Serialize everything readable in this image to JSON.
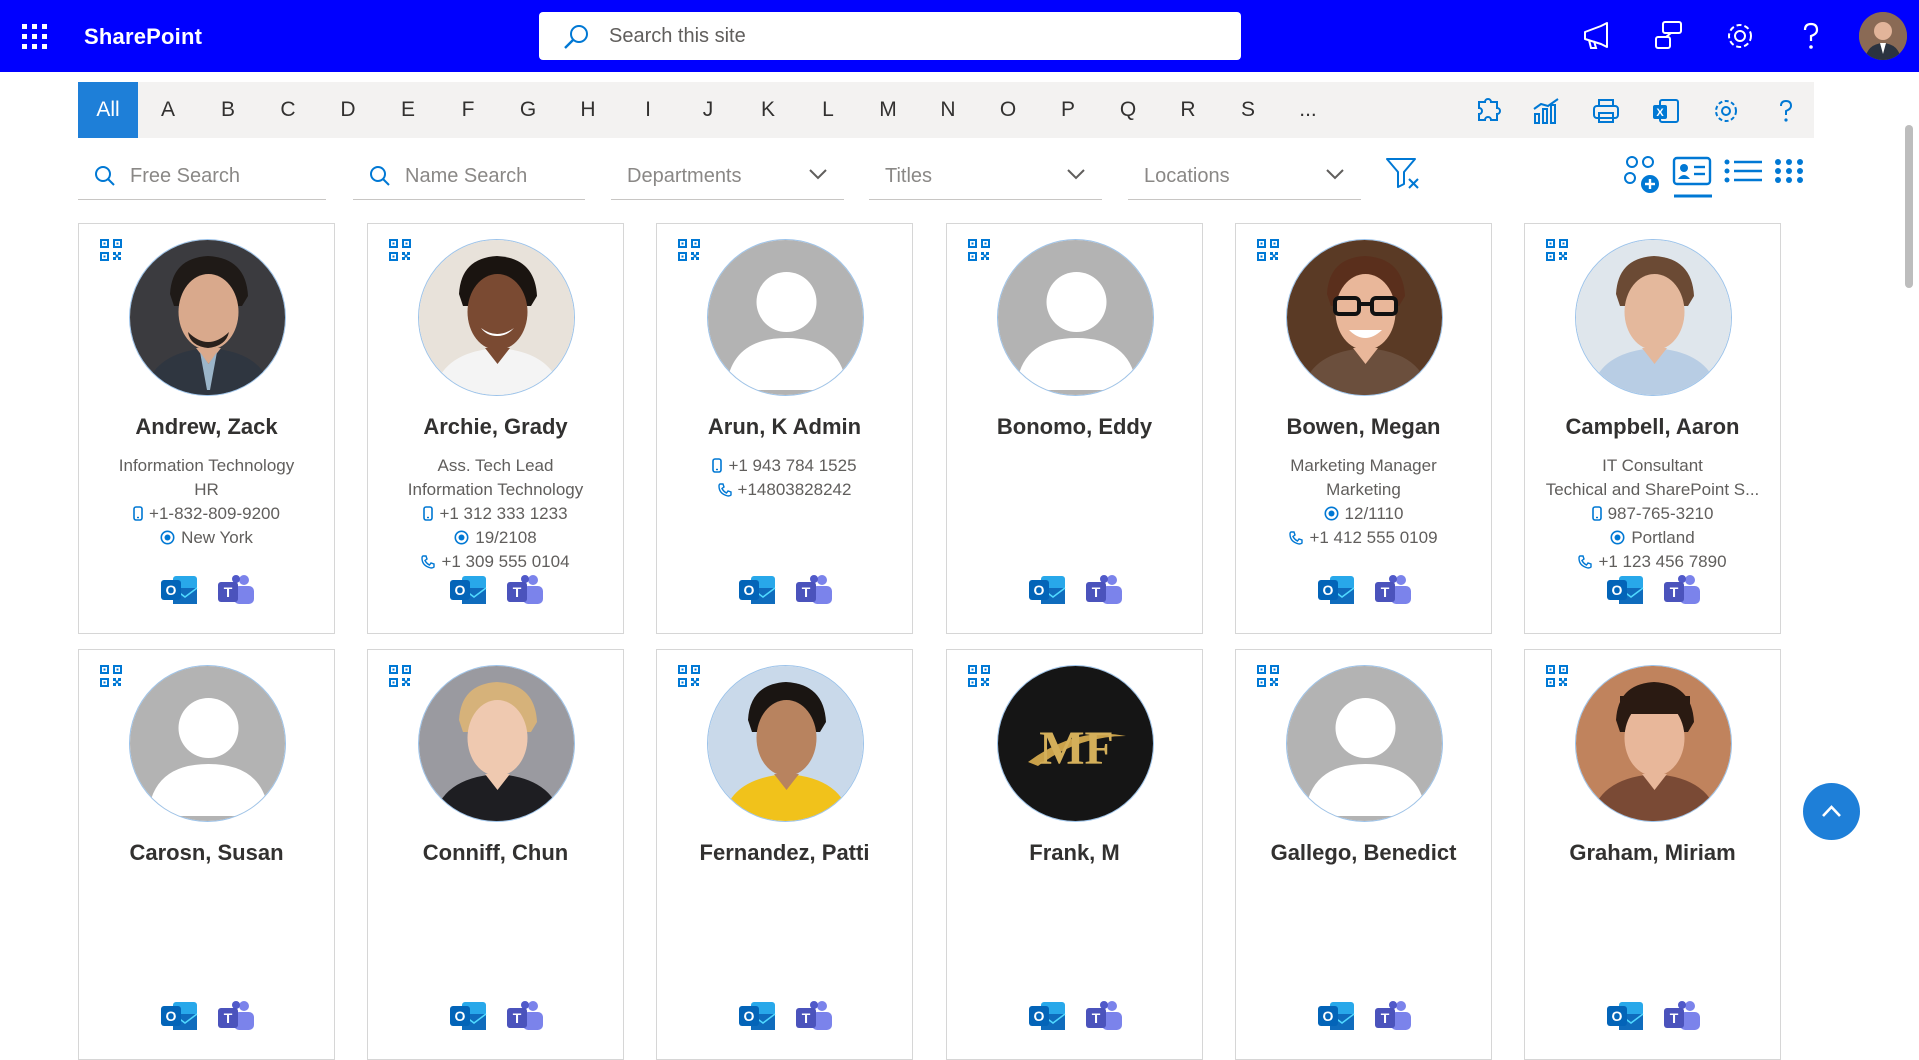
{
  "app": {
    "name": "SharePoint"
  },
  "search": {
    "placeholder": "Search this site"
  },
  "alphabet": [
    "All",
    "A",
    "B",
    "C",
    "D",
    "E",
    "F",
    "G",
    "H",
    "I",
    "J",
    "K",
    "L",
    "M",
    "N",
    "O",
    "P",
    "Q",
    "R",
    "S",
    "..."
  ],
  "active_letter": "All",
  "filters": {
    "free_search_placeholder": "Free Search",
    "name_search_placeholder": "Name Search",
    "departments": "Departments",
    "titles": "Titles",
    "locations": "Locations"
  },
  "colors": {
    "suite_bar": "#0000ff",
    "accent": "#1e7fd8",
    "outlook": "#0f6cbd",
    "teams": "#5b5fc7"
  },
  "people": [
    {
      "name": "Andrew, Zack",
      "lines": [
        {
          "icon": "",
          "text": "Information Technology"
        },
        {
          "icon": "",
          "text": "HR"
        },
        {
          "icon": "mobile-icon",
          "text": "+1-832-809-9200"
        },
        {
          "icon": "location-icon",
          "text": "New York"
        }
      ]
    },
    {
      "name": "Archie, Grady",
      "lines": [
        {
          "icon": "",
          "text": "Ass. Tech Lead"
        },
        {
          "icon": "",
          "text": "Information Technology"
        },
        {
          "icon": "mobile-icon",
          "text": "+1 312 333 1233"
        },
        {
          "icon": "location-icon",
          "text": "19/2108"
        },
        {
          "icon": "phone-icon",
          "text": "+1 309 555 0104"
        }
      ]
    },
    {
      "name": "Arun, K Admin",
      "lines": [
        {
          "icon": "mobile-icon",
          "text": "+1 943 784 1525"
        },
        {
          "icon": "phone-icon",
          "text": "+14803828242"
        }
      ]
    },
    {
      "name": "Bonomo, Eddy",
      "lines": []
    },
    {
      "name": "Bowen, Megan",
      "lines": [
        {
          "icon": "",
          "text": "Marketing Manager"
        },
        {
          "icon": "",
          "text": "Marketing"
        },
        {
          "icon": "location-icon",
          "text": "12/1110"
        },
        {
          "icon": "phone-icon",
          "text": "+1 412 555 0109"
        }
      ]
    },
    {
      "name": "Campbell, Aaron",
      "lines": [
        {
          "icon": "",
          "text": "IT Consultant"
        },
        {
          "icon": "",
          "text": "Techical and SharePoint S..."
        },
        {
          "icon": "mobile-icon",
          "text": "987-765-3210"
        },
        {
          "icon": "location-icon",
          "text": "Portland"
        },
        {
          "icon": "phone-icon",
          "text": "+1 123 456 7890"
        }
      ]
    },
    {
      "name": "Carosn, Susan",
      "lines": []
    },
    {
      "name": "Conniff, Chun",
      "lines": []
    },
    {
      "name": "Fernandez, Patti",
      "lines": []
    },
    {
      "name": "Frank, M",
      "lines": []
    },
    {
      "name": "Gallego, Benedict",
      "lines": []
    },
    {
      "name": "Graham, Miriam",
      "lines": []
    }
  ]
}
